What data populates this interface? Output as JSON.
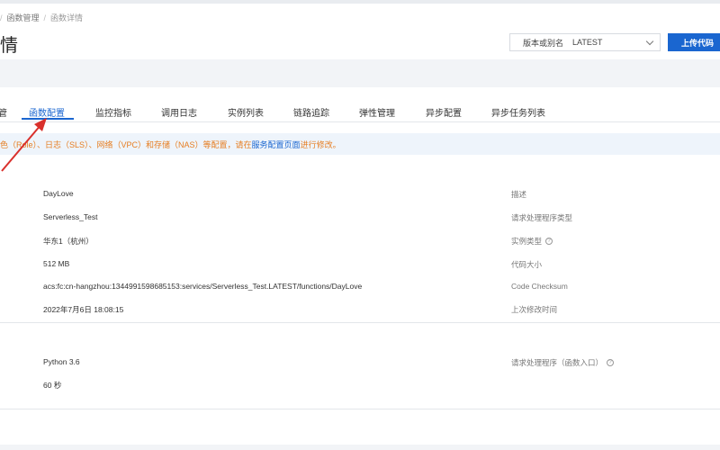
{
  "breadcrumb": {
    "parent": "函数管理",
    "current": "函数详情"
  },
  "page": {
    "title": "情"
  },
  "header": {
    "version_label": "版本或别名",
    "version_value": "LATEST",
    "upload_label": "上传代码"
  },
  "tabs": [
    {
      "label": "管"
    },
    {
      "label": "函数配置",
      "active": true
    },
    {
      "label": "监控指标"
    },
    {
      "label": "调用日志"
    },
    {
      "label": "实例列表"
    },
    {
      "label": "链路追踪"
    },
    {
      "label": "弹性管理"
    },
    {
      "label": "异步配置"
    },
    {
      "label": "异步任务列表"
    }
  ],
  "notice": {
    "text": "色（Role）、日志（SLS）、网络（VPC）和存储（NAS）等配置，请在",
    "link": "服务配置页面",
    "suffix": "进行修改。"
  },
  "basic": {
    "values": [
      "DayLove",
      "Serverless_Test",
      "华东1（杭州）",
      "512 MB",
      "acs:fc:cn-hangzhou:1344991598685153:services/Serverless_Test.LATEST/functions/DayLove",
      "2022年7月6日 18:08:15"
    ],
    "labels": [
      "描述",
      "请求处理程序类型",
      "实例类型",
      "代码大小",
      "Code Checksum",
      "上次修改时间"
    ]
  },
  "env": {
    "values": [
      "Python 3.6",
      "60 秒"
    ],
    "labels": [
      "请求处理程序（函数入口）"
    ]
  },
  "colors": {
    "accent": "#1a66d0",
    "warning": "#e67e22",
    "annotation": "#d9302c"
  }
}
